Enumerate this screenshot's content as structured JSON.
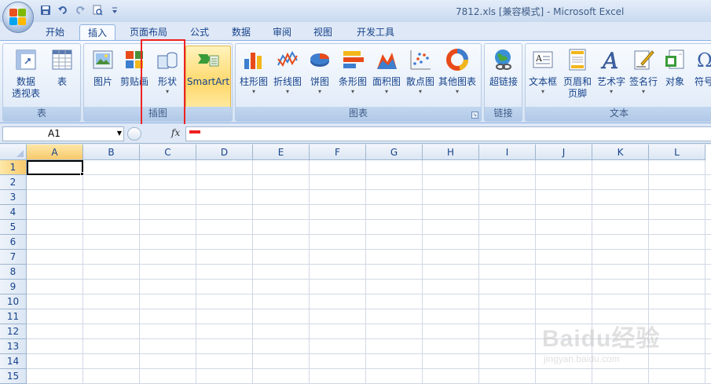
{
  "window": {
    "title": "7812.xls  [兼容模式] - Microsoft Excel"
  },
  "quick_access": {
    "items": [
      {
        "icon": "save-icon"
      },
      {
        "icon": "undo-icon"
      },
      {
        "icon": "redo-icon"
      },
      {
        "icon": "print-preview-icon"
      },
      {
        "icon": "customize-qat-icon"
      }
    ]
  },
  "tabs": [
    {
      "label": "开始",
      "active": false
    },
    {
      "label": "插入",
      "active": true
    },
    {
      "label": "页面布局",
      "active": false
    },
    {
      "label": "公式",
      "active": false
    },
    {
      "label": "数据",
      "active": false
    },
    {
      "label": "审阅",
      "active": false
    },
    {
      "label": "视图",
      "active": false
    },
    {
      "label": "开发工具",
      "active": false
    }
  ],
  "ribbon": {
    "groups": [
      {
        "label": "表",
        "buttons": [
          {
            "label": "数据\n透视表",
            "icon": "pivot-table-icon",
            "dropdown": true
          },
          {
            "label": "表",
            "icon": "table-icon",
            "dropdown": false
          }
        ]
      },
      {
        "label": "插图",
        "buttons": [
          {
            "label": "图片",
            "icon": "picture-icon",
            "dropdown": false
          },
          {
            "label": "剪贴画",
            "icon": "clip-art-icon",
            "dropdown": false
          },
          {
            "label": "形状",
            "icon": "shapes-icon",
            "dropdown": true
          },
          {
            "label": "SmartArt",
            "icon": "smartart-icon",
            "dropdown": false
          }
        ]
      },
      {
        "label": "图表",
        "buttons": [
          {
            "label": "柱形图",
            "icon": "column-chart-icon",
            "dropdown": true
          },
          {
            "label": "折线图",
            "icon": "line-chart-icon",
            "dropdown": true
          },
          {
            "label": "饼图",
            "icon": "pie-chart-icon",
            "dropdown": true
          },
          {
            "label": "条形图",
            "icon": "bar-chart-icon",
            "dropdown": true
          },
          {
            "label": "面积图",
            "icon": "area-chart-icon",
            "dropdown": true
          },
          {
            "label": "散点图",
            "icon": "scatter-chart-icon",
            "dropdown": true
          },
          {
            "label": "其他图表",
            "icon": "other-charts-icon",
            "dropdown": true
          }
        ]
      },
      {
        "label": "链接",
        "buttons": [
          {
            "label": "超链接",
            "icon": "hyperlink-icon",
            "dropdown": false
          }
        ]
      },
      {
        "label": "文本",
        "buttons": [
          {
            "label": "文本框",
            "icon": "textbox-icon",
            "dropdown": true
          },
          {
            "label": "页眉和\n页脚",
            "icon": "header-footer-icon",
            "dropdown": false
          },
          {
            "label": "艺术字",
            "icon": "wordart-icon",
            "dropdown": true
          },
          {
            "label": "签名行",
            "icon": "signature-line-icon",
            "dropdown": true
          },
          {
            "label": "对象",
            "icon": "object-icon",
            "dropdown": false
          },
          {
            "label": "符号",
            "icon": "symbol-icon",
            "dropdown": false
          }
        ]
      }
    ]
  },
  "formula_bar": {
    "name_box": "A1",
    "fx_label": "fx",
    "formula": ""
  },
  "sheet": {
    "columns": [
      "A",
      "B",
      "C",
      "D",
      "E",
      "F",
      "G",
      "H",
      "I",
      "J",
      "K",
      "L"
    ],
    "rows": [
      "1",
      "2",
      "3",
      "4",
      "5",
      "6",
      "7",
      "8",
      "9",
      "10",
      "11",
      "12",
      "13",
      "14",
      "15"
    ],
    "selected_cell": "A1"
  },
  "watermark": {
    "text": "Baidu经验",
    "url": "jingyan.baidu.com"
  }
}
